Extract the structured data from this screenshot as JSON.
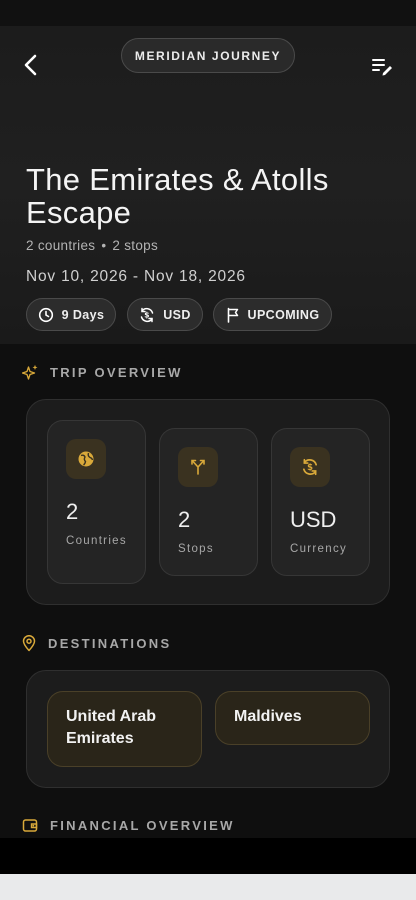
{
  "header": {
    "brand": "MERIDIAN JOURNEY",
    "back_icon": "chevron-left-icon",
    "menu_icon": "edit-list-icon"
  },
  "trip": {
    "title": "The Emirates & Atolls Escape",
    "countries_text": "2 countries",
    "separator": "•",
    "stops_text": "2 stops",
    "dates": "Nov 10, 2026 - Nov 18, 2026",
    "chips": [
      {
        "label": "9 Days",
        "icon": "clock-icon"
      },
      {
        "label": "USD",
        "icon": "currency-exchange-icon"
      },
      {
        "label": "UPCOMING",
        "icon": "flag-icon"
      }
    ]
  },
  "overview": {
    "title": "TRIP OVERVIEW",
    "icon": "sparkles-icon",
    "stats": [
      {
        "value": "2",
        "label": "Countries",
        "icon": "globe-icon"
      },
      {
        "value": "2",
        "label": "Stops",
        "icon": "route-fork-icon"
      },
      {
        "value": "USD",
        "label": "Currency",
        "icon": "currency-exchange-icon"
      }
    ]
  },
  "destinations": {
    "title": "DESTINATIONS",
    "icon": "map-pin-icon",
    "items": [
      "United Arab Emirates",
      "Maldives"
    ]
  },
  "financial": {
    "title": "FINANCIAL OVERVIEW",
    "icon": "wallet-icon"
  },
  "colors": {
    "accent": "#d9a93a",
    "background": "#0f0f0f",
    "panel": "#1c1c1c"
  }
}
